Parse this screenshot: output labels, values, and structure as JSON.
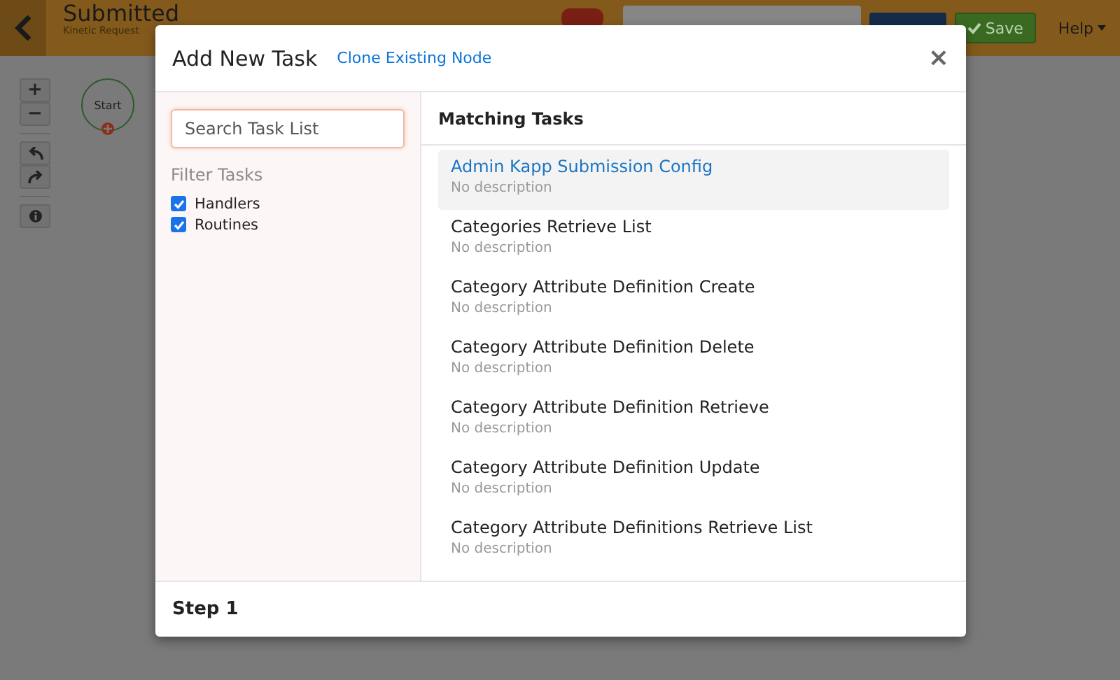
{
  "topbar": {
    "title": "Submitted",
    "subtitle": "Kinetic Request",
    "save": "Save",
    "help": "Help"
  },
  "canvas": {
    "zoom_in": "+",
    "zoom_out": "−",
    "start_node": "Start"
  },
  "modal": {
    "title": "Add New Task",
    "clone_link": "Clone Existing Node",
    "close": "×",
    "search": {
      "placeholder": "Search Task List"
    },
    "filter_heading": "Filter Tasks",
    "filters": [
      {
        "label": "Handlers",
        "checked": true
      },
      {
        "label": "Routines",
        "checked": true
      }
    ],
    "list_heading": "Matching Tasks",
    "tasks": [
      {
        "name": "Admin Kapp Submission Config",
        "description": "No description",
        "selected": true
      },
      {
        "name": "Categories Retrieve List",
        "description": "No description",
        "selected": false
      },
      {
        "name": "Category Attribute Definition Create",
        "description": "No description",
        "selected": false
      },
      {
        "name": "Category Attribute Definition Delete",
        "description": "No description",
        "selected": false
      },
      {
        "name": "Category Attribute Definition Retrieve",
        "description": "No description",
        "selected": false
      },
      {
        "name": "Category Attribute Definition Update",
        "description": "No description",
        "selected": false
      },
      {
        "name": "Category Attribute Definitions Retrieve List",
        "description": "No description",
        "selected": false
      }
    ],
    "footer": "Step 1"
  }
}
